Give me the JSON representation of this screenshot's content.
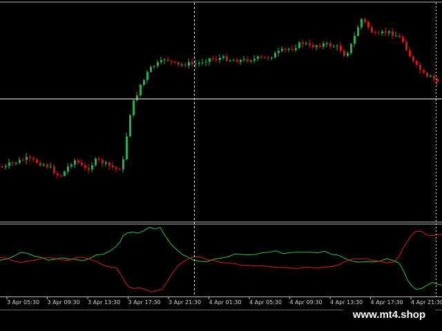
{
  "colors": {
    "background": "#000000",
    "bull_candle": "#22b24c",
    "bear_candle": "#e01010",
    "crosshair": "#ffffff",
    "panel_separator": "#bfbfbf",
    "plus_di_line": "#31c23c",
    "minus_di_line": "#d81e1e",
    "axis_text": "#d8d8d8"
  },
  "chart_data": [
    {
      "type": "candlestick",
      "name": "price",
      "grid": false,
      "crosshair": true,
      "x": [
        "3 Apr 05:30",
        "3 Apr 09:30",
        "3 Apr 13:30",
        "3 Apr 17:30",
        "3 Apr 21:30",
        "4 Apr 01:30",
        "4 Apr 05:30",
        "4 Apr 09:30",
        "4 Apr 13:30",
        "4 Apr 17:30",
        "4 Apr 21:30"
      ],
      "close_path": [
        [
          0,
          242
        ],
        [
          6,
          243
        ],
        [
          12,
          238
        ],
        [
          20,
          236
        ],
        [
          28,
          233
        ],
        [
          36,
          230
        ],
        [
          44,
          232
        ],
        [
          52,
          235
        ],
        [
          60,
          238
        ],
        [
          66,
          240
        ],
        [
          72,
          244
        ],
        [
          78,
          250
        ],
        [
          84,
          256
        ],
        [
          90,
          252
        ],
        [
          96,
          243
        ],
        [
          102,
          236
        ],
        [
          108,
          232
        ],
        [
          114,
          238
        ],
        [
          120,
          245
        ],
        [
          126,
          244
        ],
        [
          132,
          238
        ],
        [
          138,
          232
        ],
        [
          144,
          234
        ],
        [
          150,
          238
        ],
        [
          156,
          240
        ],
        [
          162,
          243
        ],
        [
          168,
          246
        ],
        [
          174,
          242
        ],
        [
          178,
          230
        ],
        [
          181,
          205
        ],
        [
          184,
          180
        ],
        [
          188,
          160
        ],
        [
          192,
          148
        ],
        [
          196,
          140
        ],
        [
          200,
          125
        ],
        [
          205,
          120
        ],
        [
          210,
          110
        ],
        [
          214,
          102
        ],
        [
          220,
          96
        ],
        [
          226,
          93
        ],
        [
          232,
          90
        ],
        [
          238,
          84
        ],
        [
          244,
          88
        ],
        [
          250,
          92
        ],
        [
          256,
          95
        ],
        [
          262,
          94
        ],
        [
          270,
          92
        ],
        [
          278,
          93
        ],
        [
          286,
          92
        ],
        [
          294,
          88
        ],
        [
          302,
          85
        ],
        [
          310,
          86
        ],
        [
          318,
          84
        ],
        [
          326,
          85
        ],
        [
          334,
          87
        ],
        [
          342,
          87
        ],
        [
          350,
          88
        ],
        [
          358,
          86
        ],
        [
          366,
          86
        ],
        [
          374,
          84
        ],
        [
          382,
          85
        ],
        [
          390,
          82
        ],
        [
          398,
          78
        ],
        [
          406,
          74
        ],
        [
          414,
          72
        ],
        [
          422,
          70
        ],
        [
          430,
          65
        ],
        [
          436,
          62
        ],
        [
          442,
          64
        ],
        [
          448,
          68
        ],
        [
          454,
          66
        ],
        [
          460,
          65
        ],
        [
          468,
          64
        ],
        [
          474,
          66
        ],
        [
          480,
          66
        ],
        [
          486,
          68
        ],
        [
          492,
          72
        ],
        [
          498,
          80
        ],
        [
          504,
          72
        ],
        [
          510,
          58
        ],
        [
          514,
          48
        ],
        [
          518,
          36
        ],
        [
          522,
          28
        ],
        [
          528,
          34
        ],
        [
          534,
          42
        ],
        [
          540,
          50
        ],
        [
          546,
          52
        ],
        [
          552,
          48
        ],
        [
          558,
          46
        ],
        [
          564,
          48
        ],
        [
          570,
          50
        ],
        [
          576,
          54
        ],
        [
          582,
          60
        ],
        [
          588,
          72
        ],
        [
          594,
          85
        ],
        [
          600,
          95
        ],
        [
          606,
          100
        ],
        [
          612,
          108
        ],
        [
          618,
          114
        ],
        [
          624,
          112
        ],
        [
          630,
          118
        ],
        [
          636,
          120
        ],
        [
          640,
          122
        ]
      ]
    },
    {
      "type": "line",
      "name": "indicator",
      "grid": false,
      "series": [
        {
          "color": "#31c23c",
          "points": [
            [
              0,
              377
            ],
            [
              10,
              376
            ],
            [
              20,
              371
            ],
            [
              30,
              366
            ],
            [
              40,
              368
            ],
            [
              50,
              371
            ],
            [
              60,
              374
            ],
            [
              70,
              377
            ],
            [
              80,
              376
            ],
            [
              90,
              374
            ],
            [
              100,
              375
            ],
            [
              110,
              377
            ],
            [
              120,
              378
            ],
            [
              130,
              375
            ],
            [
              140,
              370
            ],
            [
              150,
              368
            ],
            [
              160,
              363
            ],
            [
              168,
              358
            ],
            [
              174,
              350
            ],
            [
              178,
              343
            ],
            [
              184,
              338
            ],
            [
              192,
              336
            ],
            [
              200,
              339
            ],
            [
              208,
              335
            ],
            [
              216,
              330
            ],
            [
              224,
              333
            ],
            [
              232,
              330
            ],
            [
              240,
              343
            ],
            [
              248,
              355
            ],
            [
              256,
              363
            ],
            [
              264,
              369
            ],
            [
              272,
              373
            ],
            [
              280,
              377
            ],
            [
              290,
              380
            ],
            [
              300,
              379
            ],
            [
              310,
              376
            ],
            [
              320,
              374
            ],
            [
              330,
              372
            ],
            [
              340,
              369
            ],
            [
              350,
              368
            ],
            [
              360,
              369
            ],
            [
              370,
              368
            ],
            [
              380,
              367
            ],
            [
              390,
              366
            ],
            [
              400,
              364
            ],
            [
              410,
              367
            ],
            [
              420,
              366
            ],
            [
              430,
              365
            ],
            [
              440,
              366
            ],
            [
              450,
              366
            ],
            [
              460,
              366
            ],
            [
              470,
              365
            ],
            [
              480,
              368
            ],
            [
              490,
              370
            ],
            [
              500,
              375
            ],
            [
              510,
              379
            ],
            [
              520,
              380
            ],
            [
              530,
              380
            ],
            [
              540,
              380
            ],
            [
              550,
              379
            ],
            [
              560,
              376
            ],
            [
              570,
              378
            ],
            [
              578,
              382
            ],
            [
              584,
              393
            ],
            [
              590,
              405
            ],
            [
              596,
              414
            ],
            [
              602,
              420
            ],
            [
              610,
              419
            ],
            [
              618,
              413
            ],
            [
              626,
              410
            ],
            [
              634,
              412
            ],
            [
              640,
              413
            ]
          ]
        },
        {
          "color": "#d81e1e",
          "points": [
            [
              0,
              373
            ],
            [
              10,
              375
            ],
            [
              20,
              378
            ],
            [
              30,
              381
            ],
            [
              40,
              379
            ],
            [
              50,
              377
            ],
            [
              60,
              375
            ],
            [
              70,
              373
            ],
            [
              80,
              375
            ],
            [
              90,
              377
            ],
            [
              100,
              377
            ],
            [
              110,
              374
            ],
            [
              120,
              373
            ],
            [
              130,
              376
            ],
            [
              140,
              380
            ],
            [
              150,
              384
            ],
            [
              160,
              387
            ],
            [
              168,
              389
            ],
            [
              174,
              396
            ],
            [
              180,
              408
            ],
            [
              186,
              416
            ],
            [
              194,
              418
            ],
            [
              202,
              418
            ],
            [
              210,
              420
            ],
            [
              220,
              424
            ],
            [
              228,
              422
            ],
            [
              234,
              420
            ],
            [
              242,
              408
            ],
            [
              250,
              396
            ],
            [
              258,
              386
            ],
            [
              266,
              379
            ],
            [
              274,
              375
            ],
            [
              282,
              372
            ],
            [
              290,
              374
            ],
            [
              300,
              376
            ],
            [
              310,
              378
            ],
            [
              320,
              380
            ],
            [
              330,
              381
            ],
            [
              340,
              383
            ],
            [
              350,
              384
            ],
            [
              360,
              384
            ],
            [
              370,
              385
            ],
            [
              380,
              386
            ],
            [
              390,
              387
            ],
            [
              400,
              388
            ],
            [
              410,
              387
            ],
            [
              420,
              388
            ],
            [
              430,
              389
            ],
            [
              440,
              388
            ],
            [
              450,
              388
            ],
            [
              460,
              388
            ],
            [
              470,
              388
            ],
            [
              480,
              386
            ],
            [
              490,
              384
            ],
            [
              500,
              379
            ],
            [
              510,
              376
            ],
            [
              520,
              375
            ],
            [
              530,
              376
            ],
            [
              540,
              378
            ],
            [
              550,
              379
            ],
            [
              560,
              382
            ],
            [
              570,
              380
            ],
            [
              578,
              372
            ],
            [
              584,
              360
            ],
            [
              590,
              349
            ],
            [
              596,
              341
            ],
            [
              602,
              336
            ],
            [
              610,
              336
            ],
            [
              618,
              340
            ],
            [
              626,
              342
            ],
            [
              634,
              340
            ],
            [
              640,
              340
            ]
          ]
        }
      ]
    }
  ],
  "watermark": {
    "text": "www.mt4.shop"
  }
}
